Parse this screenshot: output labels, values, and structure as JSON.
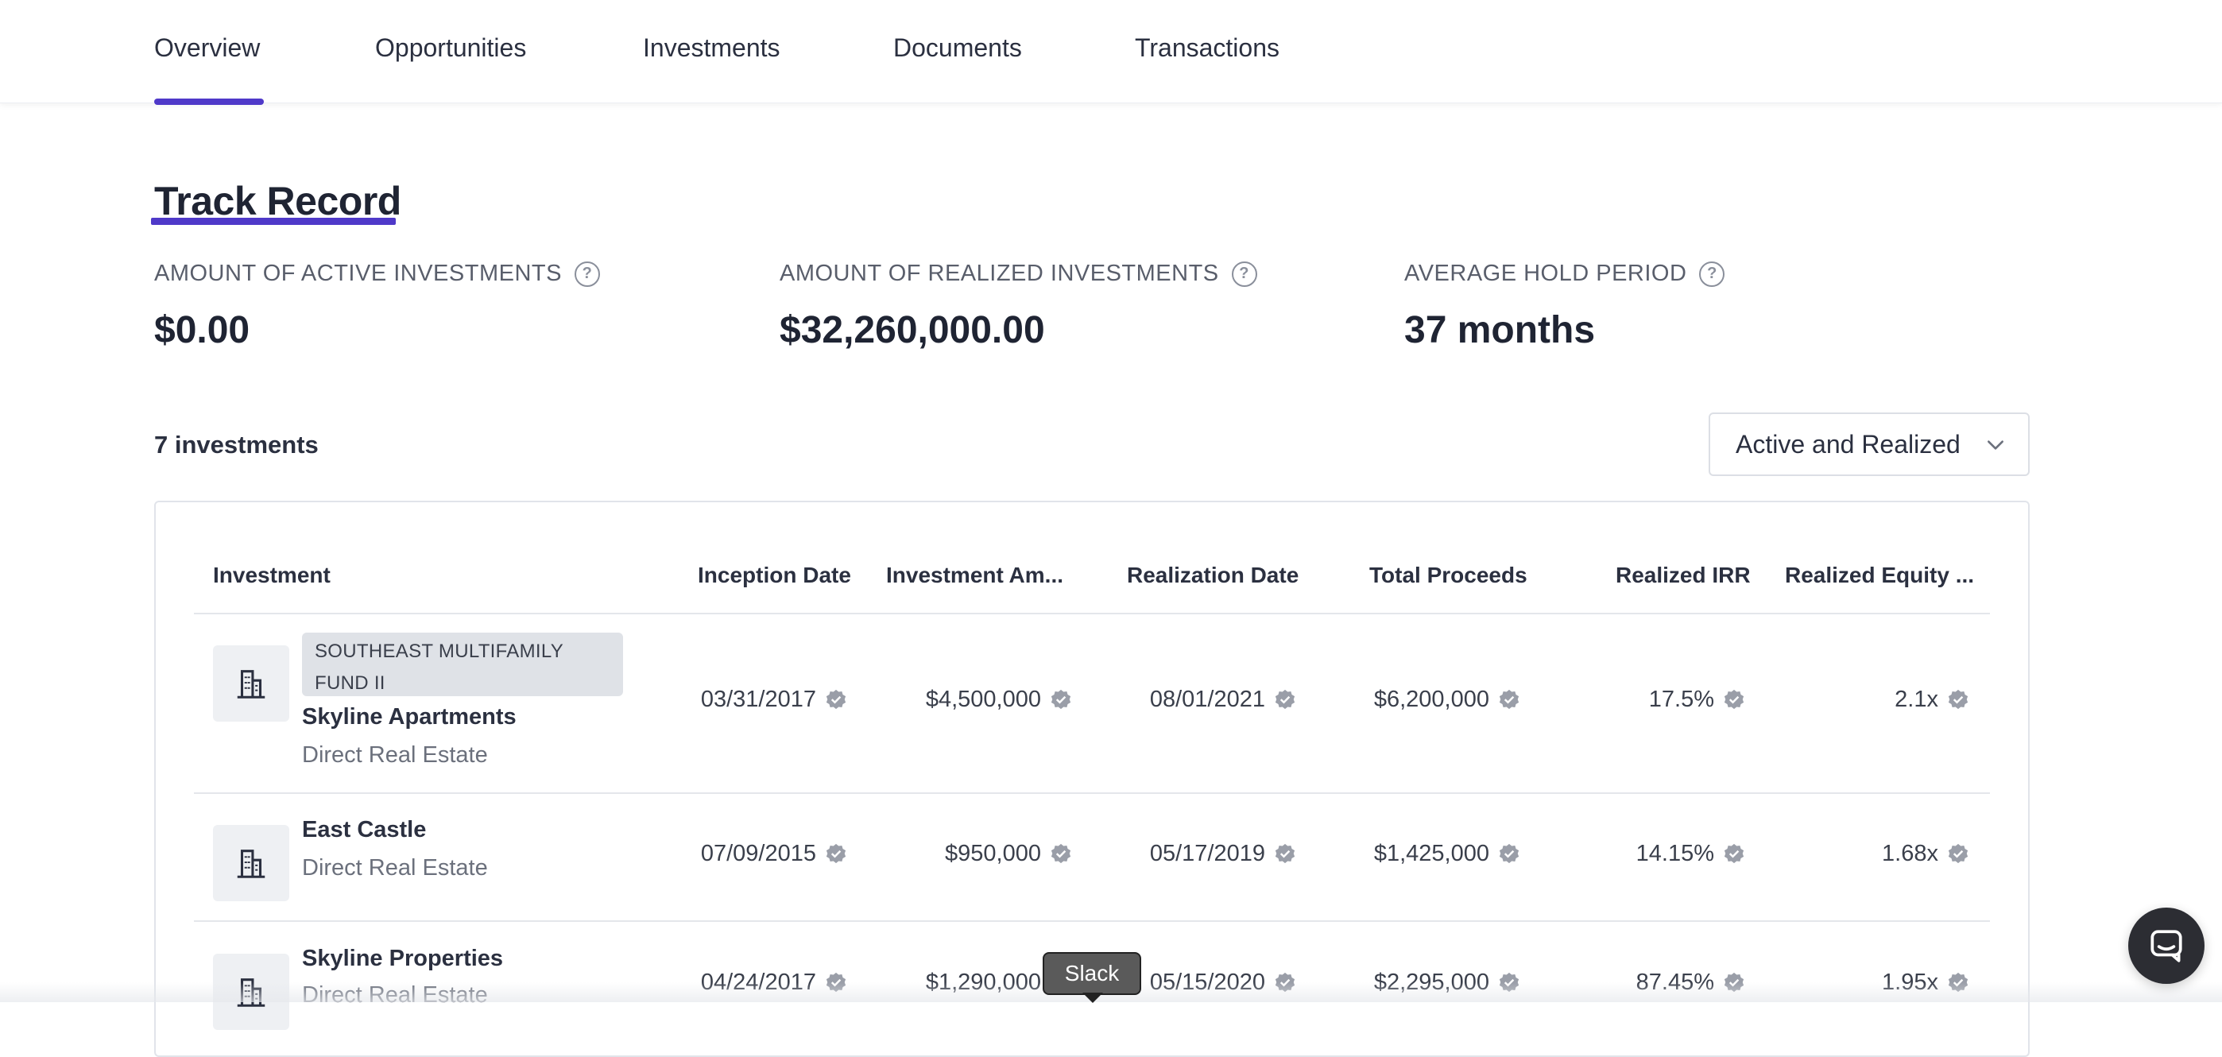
{
  "nav": {
    "tabs": [
      {
        "label": "Overview",
        "active": true
      },
      {
        "label": "Opportunities"
      },
      {
        "label": "Investments"
      },
      {
        "label": "Documents"
      },
      {
        "label": "Transactions"
      }
    ],
    "accent_color": "#4f39c9"
  },
  "track_record": {
    "title": "Track Record",
    "stats": [
      {
        "label": "AMOUNT OF ACTIVE INVESTMENTS",
        "value": "$0.00",
        "help_icon": "question-circle-icon"
      },
      {
        "label": "AMOUNT OF REALIZED INVESTMENTS",
        "value": "$32,260,000.00",
        "help_icon": "question-circle-icon"
      },
      {
        "label": "AVERAGE HOLD PERIOD",
        "value": "37 months",
        "help_icon": "question-circle-icon"
      }
    ]
  },
  "investments": {
    "count_label": "7 investments",
    "filter": {
      "selected": "Active and Realized",
      "icon": "chevron-down-icon"
    },
    "columns": [
      "Investment",
      "Inception Date",
      "Investment Am...",
      "Realization Date",
      "Total Proceeds",
      "Realized IRR",
      "Realized Equity ..."
    ],
    "rows": [
      {
        "fund": "SOUTHEAST MULTIFAMILY FUND II",
        "name": "Skyline Apartments",
        "type": "Direct Real Estate",
        "inception": "03/31/2017",
        "amount": "$4,500,000",
        "realization": "08/01/2021",
        "proceeds": "$6,200,000",
        "irr": "17.5%",
        "multiple": "2.1x"
      },
      {
        "fund": "",
        "name": "East Castle",
        "type": "Direct Real Estate",
        "inception": "07/09/2015",
        "amount": "$950,000",
        "realization": "05/17/2019",
        "proceeds": "$1,425,000",
        "irr": "14.15%",
        "multiple": "1.68x"
      },
      {
        "fund": "",
        "name": "Skyline Properties",
        "type": "Direct Real Estate",
        "inception": "04/24/2017",
        "amount": "$1,290,000",
        "realization": "05/15/2020",
        "proceeds": "$2,295,000",
        "irr": "87.45%",
        "multiple": "1.95x"
      }
    ],
    "row_icon": "building-icon",
    "verified_icon": "verified-badge-icon"
  },
  "tooltip": {
    "text": "Slack"
  },
  "chat": {
    "icon": "chat-bubble-icon"
  }
}
